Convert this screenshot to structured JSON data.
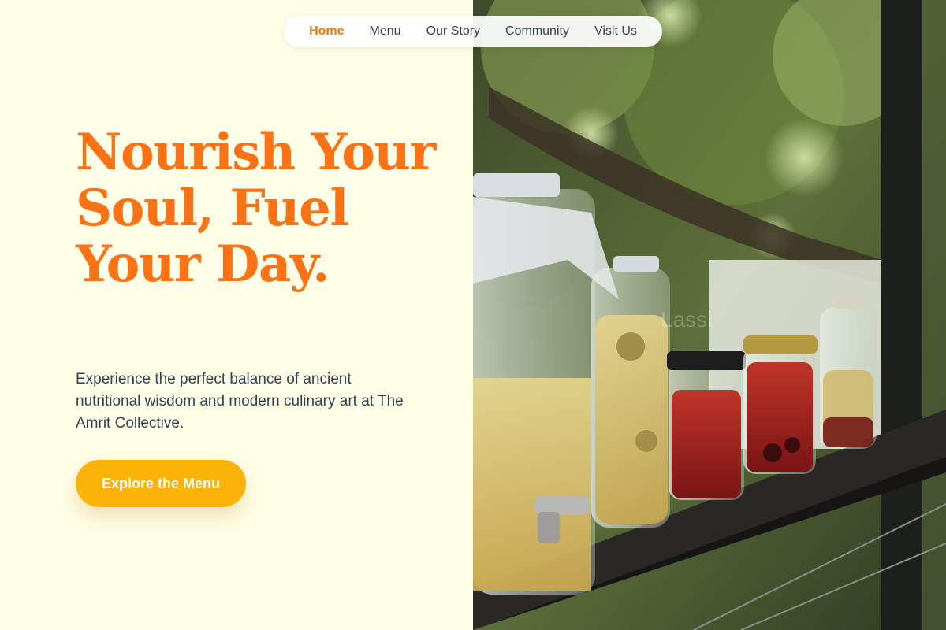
{
  "nav": {
    "items": [
      {
        "label": "Home",
        "active": true
      },
      {
        "label": "Menu",
        "active": false
      },
      {
        "label": "Our Story",
        "active": false
      },
      {
        "label": "Community",
        "active": false
      },
      {
        "label": "Visit Us",
        "active": false
      }
    ]
  },
  "hero": {
    "title": "Nourish Your Soul, Fuel Your Day.",
    "subtitle": "Experience the perfect balance of ancient nutritional wisdom and modern culinary art at The Amrit Collective.",
    "cta_label": "Explore the Menu"
  },
  "colors": {
    "background": "#FFFEE6",
    "accent": "#F97316",
    "nav_active": "#EA7A10",
    "button": "#FBB307",
    "text": "#334155"
  },
  "photo": {
    "icon": "hero-photo-jars-on-shelf",
    "watermark": "Lassi"
  }
}
